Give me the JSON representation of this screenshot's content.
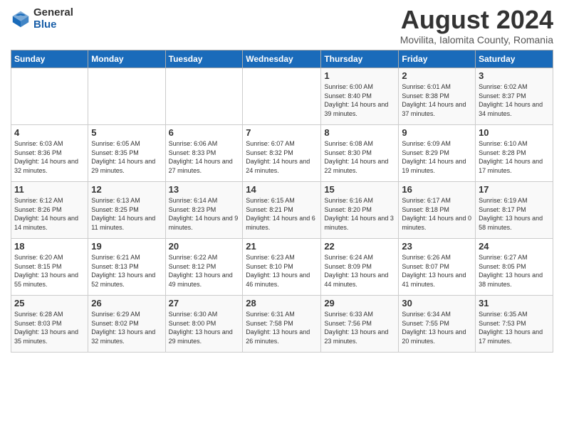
{
  "logo": {
    "general": "General",
    "blue": "Blue"
  },
  "title": "August 2024",
  "subtitle": "Movilita, Ialomita County, Romania",
  "days_header": [
    "Sunday",
    "Monday",
    "Tuesday",
    "Wednesday",
    "Thursday",
    "Friday",
    "Saturday"
  ],
  "weeks": [
    [
      {
        "day": "",
        "info": ""
      },
      {
        "day": "",
        "info": ""
      },
      {
        "day": "",
        "info": ""
      },
      {
        "day": "",
        "info": ""
      },
      {
        "day": "1",
        "info": "Sunrise: 6:00 AM\nSunset: 8:40 PM\nDaylight: 14 hours and 39 minutes."
      },
      {
        "day": "2",
        "info": "Sunrise: 6:01 AM\nSunset: 8:38 PM\nDaylight: 14 hours and 37 minutes."
      },
      {
        "day": "3",
        "info": "Sunrise: 6:02 AM\nSunset: 8:37 PM\nDaylight: 14 hours and 34 minutes."
      }
    ],
    [
      {
        "day": "4",
        "info": "Sunrise: 6:03 AM\nSunset: 8:36 PM\nDaylight: 14 hours and 32 minutes."
      },
      {
        "day": "5",
        "info": "Sunrise: 6:05 AM\nSunset: 8:35 PM\nDaylight: 14 hours and 29 minutes."
      },
      {
        "day": "6",
        "info": "Sunrise: 6:06 AM\nSunset: 8:33 PM\nDaylight: 14 hours and 27 minutes."
      },
      {
        "day": "7",
        "info": "Sunrise: 6:07 AM\nSunset: 8:32 PM\nDaylight: 14 hours and 24 minutes."
      },
      {
        "day": "8",
        "info": "Sunrise: 6:08 AM\nSunset: 8:30 PM\nDaylight: 14 hours and 22 minutes."
      },
      {
        "day": "9",
        "info": "Sunrise: 6:09 AM\nSunset: 8:29 PM\nDaylight: 14 hours and 19 minutes."
      },
      {
        "day": "10",
        "info": "Sunrise: 6:10 AM\nSunset: 8:28 PM\nDaylight: 14 hours and 17 minutes."
      }
    ],
    [
      {
        "day": "11",
        "info": "Sunrise: 6:12 AM\nSunset: 8:26 PM\nDaylight: 14 hours and 14 minutes."
      },
      {
        "day": "12",
        "info": "Sunrise: 6:13 AM\nSunset: 8:25 PM\nDaylight: 14 hours and 11 minutes."
      },
      {
        "day": "13",
        "info": "Sunrise: 6:14 AM\nSunset: 8:23 PM\nDaylight: 14 hours and 9 minutes."
      },
      {
        "day": "14",
        "info": "Sunrise: 6:15 AM\nSunset: 8:21 PM\nDaylight: 14 hours and 6 minutes."
      },
      {
        "day": "15",
        "info": "Sunrise: 6:16 AM\nSunset: 8:20 PM\nDaylight: 14 hours and 3 minutes."
      },
      {
        "day": "16",
        "info": "Sunrise: 6:17 AM\nSunset: 8:18 PM\nDaylight: 14 hours and 0 minutes."
      },
      {
        "day": "17",
        "info": "Sunrise: 6:19 AM\nSunset: 8:17 PM\nDaylight: 13 hours and 58 minutes."
      }
    ],
    [
      {
        "day": "18",
        "info": "Sunrise: 6:20 AM\nSunset: 8:15 PM\nDaylight: 13 hours and 55 minutes."
      },
      {
        "day": "19",
        "info": "Sunrise: 6:21 AM\nSunset: 8:13 PM\nDaylight: 13 hours and 52 minutes."
      },
      {
        "day": "20",
        "info": "Sunrise: 6:22 AM\nSunset: 8:12 PM\nDaylight: 13 hours and 49 minutes."
      },
      {
        "day": "21",
        "info": "Sunrise: 6:23 AM\nSunset: 8:10 PM\nDaylight: 13 hours and 46 minutes."
      },
      {
        "day": "22",
        "info": "Sunrise: 6:24 AM\nSunset: 8:09 PM\nDaylight: 13 hours and 44 minutes."
      },
      {
        "day": "23",
        "info": "Sunrise: 6:26 AM\nSunset: 8:07 PM\nDaylight: 13 hours and 41 minutes."
      },
      {
        "day": "24",
        "info": "Sunrise: 6:27 AM\nSunset: 8:05 PM\nDaylight: 13 hours and 38 minutes."
      }
    ],
    [
      {
        "day": "25",
        "info": "Sunrise: 6:28 AM\nSunset: 8:03 PM\nDaylight: 13 hours and 35 minutes."
      },
      {
        "day": "26",
        "info": "Sunrise: 6:29 AM\nSunset: 8:02 PM\nDaylight: 13 hours and 32 minutes."
      },
      {
        "day": "27",
        "info": "Sunrise: 6:30 AM\nSunset: 8:00 PM\nDaylight: 13 hours and 29 minutes."
      },
      {
        "day": "28",
        "info": "Sunrise: 6:31 AM\nSunset: 7:58 PM\nDaylight: 13 hours and 26 minutes."
      },
      {
        "day": "29",
        "info": "Sunrise: 6:33 AM\nSunset: 7:56 PM\nDaylight: 13 hours and 23 minutes."
      },
      {
        "day": "30",
        "info": "Sunrise: 6:34 AM\nSunset: 7:55 PM\nDaylight: 13 hours and 20 minutes."
      },
      {
        "day": "31",
        "info": "Sunrise: 6:35 AM\nSunset: 7:53 PM\nDaylight: 13 hours and 17 minutes."
      }
    ]
  ]
}
